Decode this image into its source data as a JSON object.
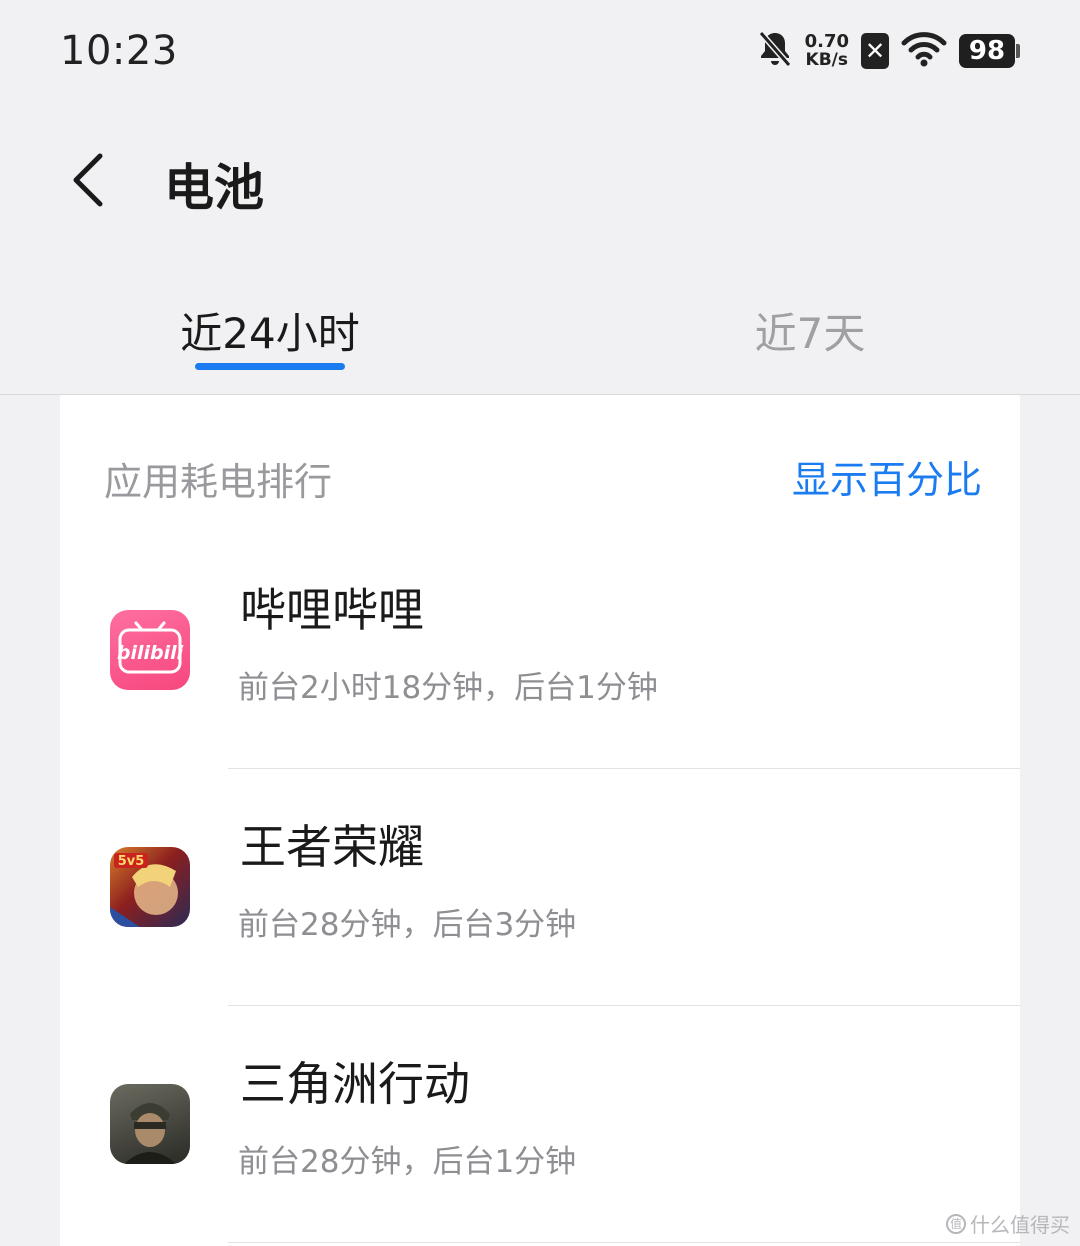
{
  "status_bar": {
    "time": "10:23",
    "net_speed_value": "0.70",
    "net_speed_unit": "KB/s",
    "battery_level": "98",
    "icons": [
      "bell-muted-icon",
      "sim-x-icon",
      "wifi-icon",
      "battery-icon"
    ]
  },
  "header": {
    "title": "电池"
  },
  "tabs": [
    {
      "label": "近24小时",
      "active": true
    },
    {
      "label": "近7天",
      "active": false
    }
  ],
  "section": {
    "title": "应用耗电排行",
    "action_label": "显示百分比"
  },
  "apps": [
    {
      "name": "哔哩哔哩",
      "usage": "前台2小时18分钟，后台1分钟",
      "icon": "bilibili-app-icon",
      "icon_text": "bilibili"
    },
    {
      "name": "王者荣耀",
      "usage": "前台28分钟，后台3分钟",
      "icon": "honor-of-kings-app-icon",
      "icon_text": "5v5"
    },
    {
      "name": "三角洲行动",
      "usage": "前台28分钟，后台1分钟",
      "icon": "delta-force-app-icon"
    }
  ],
  "watermark": {
    "text": "什么值得买",
    "symbol": "值"
  },
  "colors": {
    "accent": "#1a7cf0",
    "background": "#f1f1f3",
    "card": "#ffffff",
    "secondary_text": "#8e8e93"
  }
}
